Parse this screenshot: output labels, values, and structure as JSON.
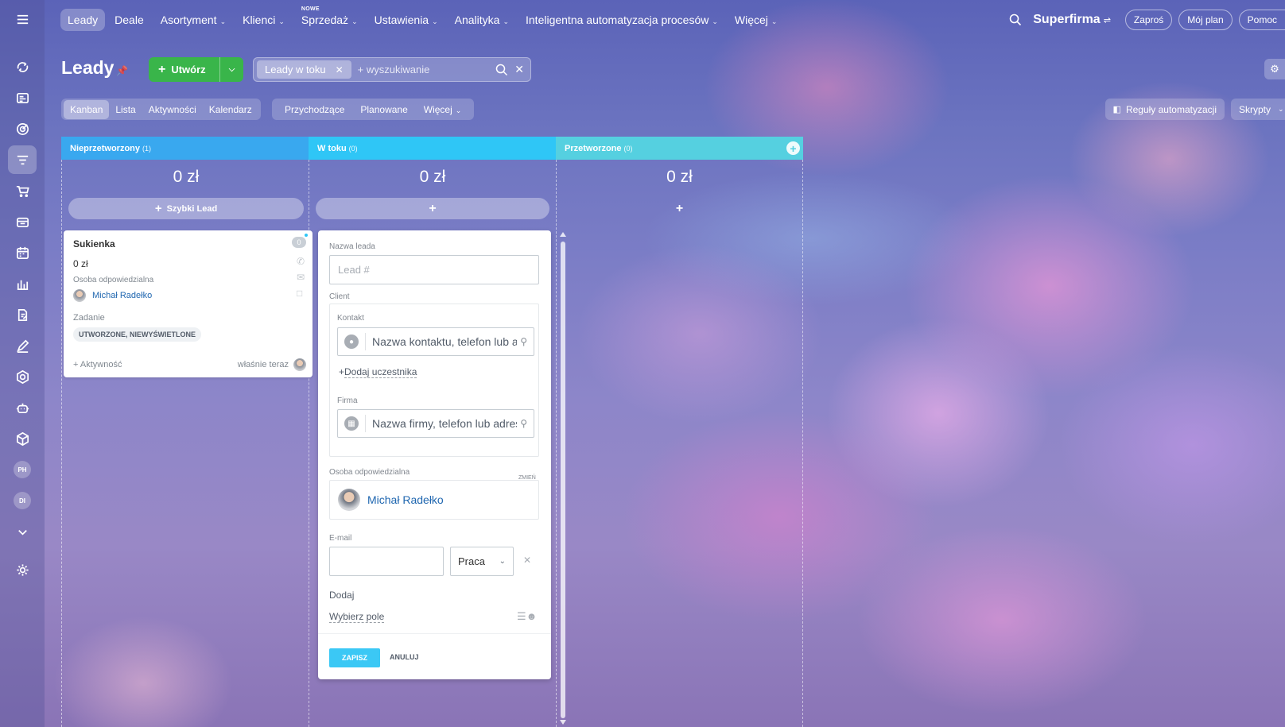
{
  "nav": {
    "items": [
      {
        "label": "Leady",
        "active": true
      },
      {
        "label": "Deale"
      },
      {
        "label": "Asortyment",
        "dropdown": true
      },
      {
        "label": "Klienci",
        "dropdown": true
      },
      {
        "label": "Sprzedaż",
        "dropdown": true,
        "badge": "NOWE"
      },
      {
        "label": "Ustawienia",
        "dropdown": true
      },
      {
        "label": "Analityka",
        "dropdown": true
      },
      {
        "label": "Inteligentna automatyzacja procesów",
        "dropdown": true
      },
      {
        "label": "Więcej",
        "dropdown": true
      }
    ],
    "brand": "Superfirma",
    "invite_label": "Zaproś",
    "plan_label": "Mój plan",
    "help_label": "Pomoc"
  },
  "sidebar": {
    "icons": [
      "menu-icon",
      "deals-icon",
      "feed-icon",
      "target-icon",
      "filter-icon",
      "cart-icon",
      "store-icon",
      "calendar-icon",
      "chart-icon",
      "document-icon",
      "sign-icon",
      "shield-icon",
      "robot-icon",
      "cube-icon",
      "chevron-down-icon",
      "settings-icon"
    ],
    "avatars": [
      "PH",
      "DI"
    ]
  },
  "header": {
    "title": "Leady",
    "create_label": "Utwórz",
    "filter_tag": "Leady w toku",
    "search_placeholder": "+ wyszukiwanie"
  },
  "views": {
    "tabs": [
      "Kanban",
      "Lista",
      "Aktywności",
      "Kalendarz"
    ],
    "active": "Kanban",
    "sub_tabs": [
      "Przychodzące",
      "Planowane",
      "Więcej"
    ],
    "automation_label": "Reguły automatyzacji",
    "scripts_label": "Skrypty"
  },
  "columns": [
    {
      "name": "Nieprzetworzony",
      "count": "(1)",
      "sum": "0 zł",
      "color": "#39a8ef",
      "button": "Szybki Lead"
    },
    {
      "name": "W toku",
      "count": "(0)",
      "sum": "0 zł",
      "color": "#2fc6f6",
      "button": "+"
    },
    {
      "name": "Przetworzone",
      "count": "(0)",
      "sum": "0 zł",
      "color": "#55d0e0",
      "button": "+"
    }
  ],
  "card": {
    "title": "Sukienka",
    "badge": "0",
    "sum": "0 zł",
    "resp_label": "Osoba odpowiedzialna",
    "resp_name": "Michał Radełko",
    "task_label": "Zadanie",
    "status": "UTWORZONE, NIEWYŚWIETLONE",
    "activity_label": "+ Aktywność",
    "time": "właśnie teraz"
  },
  "form": {
    "name_label": "Nazwa leada",
    "name_placeholder": "Lead #",
    "client_label": "Client",
    "contact_label": "Kontakt",
    "contact_placeholder": "Nazwa kontaktu, telefon lub adres e-mail",
    "add_participant": "Dodaj uczestnika",
    "company_label": "Firma",
    "company_placeholder": "Nazwa firmy, telefon lub adres e-mail",
    "resp_label": "Osoba odpowiedzialna",
    "change_label": "ZMIEŃ",
    "resp_name": "Michał Radełko",
    "email_label": "E-mail",
    "email_type": "Praca",
    "add_label": "Dodaj",
    "choose_field": "Wybierz pole",
    "save_label": "ZAPISZ",
    "cancel_label": "ANULUJ"
  }
}
